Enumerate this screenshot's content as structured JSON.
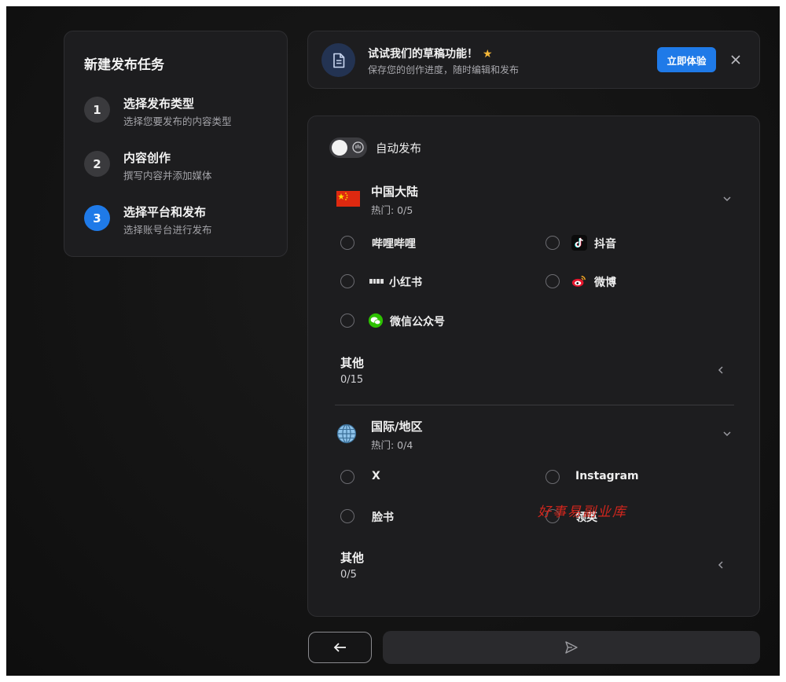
{
  "steps_panel": {
    "title": "新建发布任务",
    "steps": [
      {
        "num": "1",
        "title": "选择发布类型",
        "sub": "选择您要发布的内容类型",
        "active": false
      },
      {
        "num": "2",
        "title": "内容创作",
        "sub": "撰写内容并添加媒体",
        "active": false
      },
      {
        "num": "3",
        "title": "选择平台和发布",
        "sub": "选择账号台进行发布",
        "active": true
      }
    ]
  },
  "banner": {
    "icon": "document-icon",
    "title": "试试我们的草稿功能！",
    "subtitle": "保存您的创作进度，随时编辑和发布",
    "cta_label": "立即体验",
    "close_icon": "close-icon"
  },
  "main": {
    "auto_publish_label": "自动发布",
    "regions": [
      {
        "title": "中国大陆",
        "hot": "热门: 0/5",
        "flag": "china-flag-icon",
        "options": [
          {
            "label": "哔哩哔哩",
            "icon": ""
          },
          {
            "label": "抖音",
            "icon": "douyin-icon"
          },
          {
            "label": "小红书",
            "icon": "xiaohongshu-icon"
          },
          {
            "label": "微博",
            "icon": "weibo-icon"
          },
          {
            "label": "微信公众号",
            "icon": "wechat-icon"
          }
        ],
        "other": {
          "title": "其他",
          "count": "0/15"
        }
      },
      {
        "title": "国际/地区",
        "hot": "热门: 0/4",
        "flag": "globe-icon",
        "options": [
          {
            "label": "X",
            "icon": ""
          },
          {
            "label": "Instagram",
            "icon": ""
          },
          {
            "label": "脸书",
            "icon": ""
          },
          {
            "label": "领英",
            "icon": ""
          }
        ],
        "other": {
          "title": "其他",
          "count": "0/5"
        }
      }
    ]
  },
  "watermark": "好事易副业库",
  "colors": {
    "accent": "#1f7ae8",
    "panel": "#1d1d1f",
    "background": "#121212"
  }
}
